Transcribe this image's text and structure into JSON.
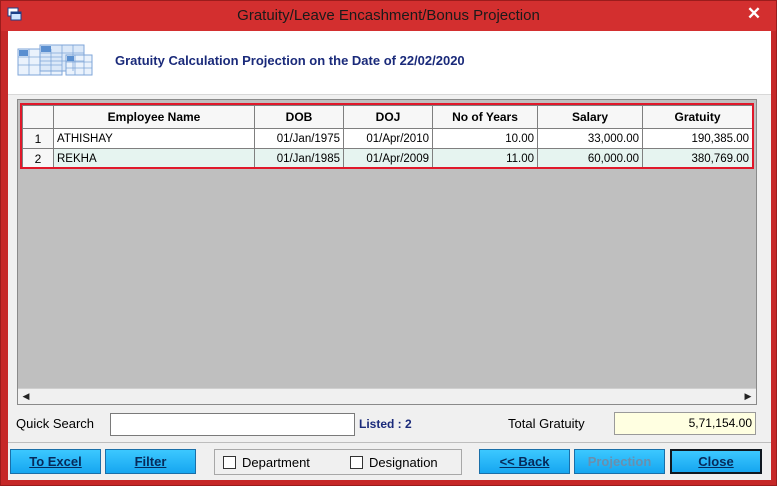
{
  "window": {
    "title": "Gratuity/Leave Encashment/Bonus Projection",
    "close_glyph": "✕"
  },
  "header": {
    "title": "Gratuity Calculation Projection on the Date of 22/02/2020"
  },
  "grid": {
    "columns": [
      "Employee Name",
      "DOB",
      "DOJ",
      "No of Years",
      "Salary",
      "Gratuity"
    ],
    "rows": [
      {
        "num": "1",
        "name": "ATHISHAY",
        "dob": "01/Jan/1975",
        "doj": "01/Apr/2010",
        "years": "10.00",
        "salary": "33,000.00",
        "gratuity": "190,385.00"
      },
      {
        "num": "2",
        "name": "REKHA",
        "dob": "01/Jan/1985",
        "doj": "01/Apr/2009",
        "years": "11.00",
        "salary": "60,000.00",
        "gratuity": "380,769.00"
      }
    ]
  },
  "footer": {
    "quick_search_label": "Quick Search",
    "quick_search_value": "",
    "listed_text": "Listed : 2",
    "total_gratuity_label": "Total Gratuity",
    "total_gratuity_value": "5,71,154.00"
  },
  "buttons": {
    "to_excel": "To Excel",
    "filter": "Filter",
    "back": "<< Back",
    "projection": "Projection",
    "close": "Close"
  },
  "checkboxes": {
    "department": "Department",
    "designation": "Designation"
  },
  "colors": {
    "title_bar": "#d32f2f",
    "highlight_outline": "#e0182a",
    "button": "#16a6f0",
    "total_field": "#ffffe1",
    "title_text": "#1a2a7a"
  }
}
